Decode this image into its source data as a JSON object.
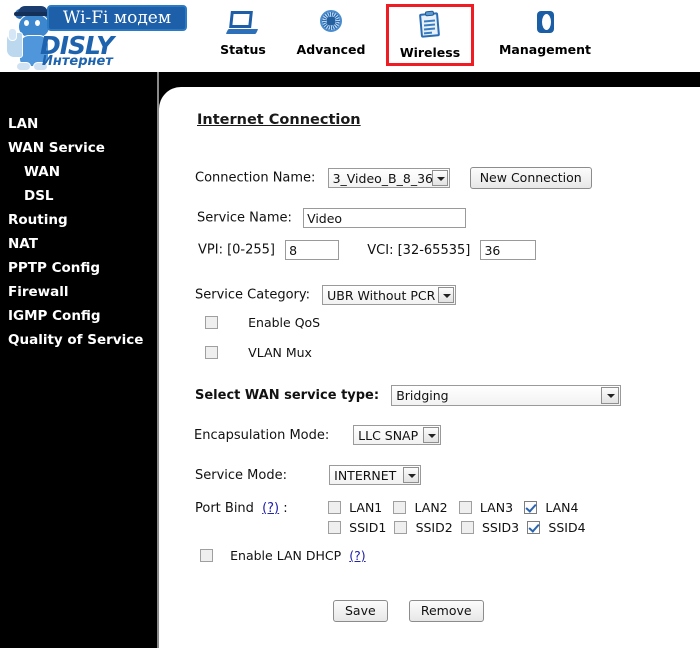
{
  "header": {
    "logo": {
      "banner_text": "Wi-Fi модем",
      "brand": "DISLY",
      "tagline": "Интернет"
    },
    "nav": [
      {
        "label": "Status",
        "icon": "monitor-icon",
        "active": false
      },
      {
        "label": "Advanced",
        "icon": "chip-icon",
        "active": false
      },
      {
        "label": "Wireless",
        "icon": "clipboard-icon",
        "active": true
      },
      {
        "label": "Management",
        "icon": "disc-icon",
        "active": false
      }
    ],
    "active_highlight_color": "#ef1c24"
  },
  "sidebar": {
    "items": [
      {
        "label": "LAN",
        "sub": false
      },
      {
        "label": "WAN Service",
        "sub": false
      },
      {
        "label": "WAN",
        "sub": true
      },
      {
        "label": "DSL",
        "sub": true
      },
      {
        "label": "Routing",
        "sub": false
      },
      {
        "label": "NAT",
        "sub": false
      },
      {
        "label": "PPTP Config",
        "sub": false
      },
      {
        "label": "Firewall",
        "sub": false
      },
      {
        "label": "IGMP Config",
        "sub": false
      },
      {
        "label": "Quality of Service",
        "sub": false
      }
    ]
  },
  "main": {
    "title": "Internet Connection",
    "connection_name": {
      "label": "Connection Name:",
      "value": "3_Video_B_8_36",
      "new_button": "New Connection"
    },
    "service_name": {
      "label": "Service Name:",
      "value": "Video"
    },
    "vpi": {
      "label": "VPI: [0-255]",
      "value": "8"
    },
    "vci": {
      "label": "VCI: [32-65535]",
      "value": "36"
    },
    "service_category": {
      "label": "Service Category:",
      "value": "UBR Without PCR"
    },
    "enable_qos": {
      "label": "Enable QoS",
      "checked": false
    },
    "vlan_mux": {
      "label": "VLAN Mux",
      "checked": false
    },
    "wan_service_type": {
      "label": "Select WAN service type:",
      "value": "Bridging"
    },
    "encapsulation_mode": {
      "label": "Encapsulation Mode:",
      "value": "LLC SNAP"
    },
    "service_mode": {
      "label": "Service Mode:",
      "value": "INTERNET"
    },
    "port_bind": {
      "label": "Port Bind",
      "help": "(?)",
      "suffix": ":",
      "lan": [
        {
          "label": "LAN1",
          "checked": false
        },
        {
          "label": "LAN2",
          "checked": false
        },
        {
          "label": "LAN3",
          "checked": false
        },
        {
          "label": "LAN4",
          "checked": true
        }
      ],
      "ssid": [
        {
          "label": "SSID1",
          "checked": false
        },
        {
          "label": "SSID2",
          "checked": false
        },
        {
          "label": "SSID3",
          "checked": false
        },
        {
          "label": "SSID4",
          "checked": true
        }
      ]
    },
    "enable_lan_dhcp": {
      "label": "Enable LAN DHCP",
      "help": "(?)",
      "checked": false
    },
    "buttons": {
      "save": "Save",
      "remove": "Remove"
    }
  }
}
